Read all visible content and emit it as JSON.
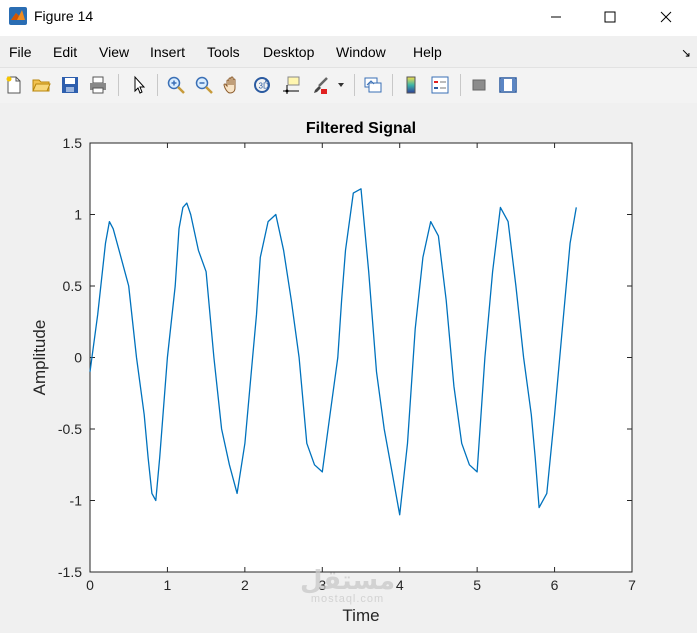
{
  "window": {
    "title": "Figure 14",
    "icon": "matlab-icon"
  },
  "menu": {
    "items": [
      "File",
      "Edit",
      "View",
      "Insert",
      "Tools",
      "Desktop",
      "Window",
      "Help"
    ]
  },
  "toolbar": {
    "icons": [
      "new-figure-icon",
      "open-file-icon",
      "save-icon",
      "print-icon",
      "pointer-icon",
      "zoom-in-icon",
      "zoom-out-icon",
      "pan-hand-icon",
      "rotate-3d-icon",
      "data-cursor-icon",
      "brush-icon",
      "brush-dropdown-icon",
      "link-plot-icon",
      "colorbar-icon",
      "legend-icon",
      "hide-plot-tools-icon",
      "show-plot-tools-icon"
    ]
  },
  "watermark": {
    "main": "مستقل",
    "sub": "mostaql.com"
  },
  "chart_data": {
    "type": "line",
    "title": "Filtered Signal",
    "xlabel": "Time",
    "ylabel": "Amplitude",
    "xlim": [
      0,
      7
    ],
    "ylim": [
      -1.5,
      1.5
    ],
    "xticks": [
      "0",
      "1",
      "2",
      "3",
      "4",
      "5",
      "6",
      "7"
    ],
    "yticks": [
      "-1.5",
      "-1",
      "-0.5",
      "0",
      "0.5",
      "1",
      "1.5"
    ],
    "grid": false,
    "line_color": "#0072bd",
    "series": [
      {
        "x": [
          0.0,
          0.1,
          0.2,
          0.25,
          0.3,
          0.4,
          0.5,
          0.6,
          0.7,
          0.75,
          0.8,
          0.85,
          0.9,
          1.0,
          1.1,
          1.15,
          1.2,
          1.25,
          1.3,
          1.4,
          1.5,
          1.6,
          1.7,
          1.8,
          1.9,
          2.0,
          2.1,
          2.15,
          2.2,
          2.3,
          2.4,
          2.5,
          2.6,
          2.7,
          2.8,
          2.9,
          3.0,
          3.1,
          3.2,
          3.25,
          3.3,
          3.4,
          3.5,
          3.6,
          3.7,
          3.8,
          3.9,
          4.0,
          4.1,
          4.2,
          4.3,
          4.4,
          4.5,
          4.6,
          4.7,
          4.8,
          4.9,
          5.0,
          5.1,
          5.2,
          5.3,
          5.4,
          5.5,
          5.6,
          5.7,
          5.75,
          5.8,
          5.9,
          6.0,
          6.1,
          6.2,
          6.28
        ],
        "y": [
          -0.1,
          0.3,
          0.8,
          0.95,
          0.9,
          0.7,
          0.5,
          0.0,
          -0.4,
          -0.7,
          -0.95,
          -1.0,
          -0.7,
          0.0,
          0.5,
          0.9,
          1.05,
          1.08,
          1.0,
          0.75,
          0.6,
          0.0,
          -0.5,
          -0.75,
          -0.95,
          -0.6,
          0.0,
          0.3,
          0.7,
          0.95,
          1.0,
          0.75,
          0.4,
          0.0,
          -0.6,
          -0.75,
          -0.8,
          -0.4,
          0.0,
          0.4,
          0.75,
          1.15,
          1.18,
          0.6,
          -0.1,
          -0.5,
          -0.8,
          -1.1,
          -0.6,
          0.2,
          0.7,
          0.95,
          0.85,
          0.4,
          -0.2,
          -0.6,
          -0.75,
          -0.8,
          0.0,
          0.6,
          1.05,
          0.95,
          0.5,
          0.0,
          -0.4,
          -0.7,
          -1.05,
          -0.95,
          -0.4,
          0.2,
          0.8,
          1.05
        ]
      }
    ]
  }
}
